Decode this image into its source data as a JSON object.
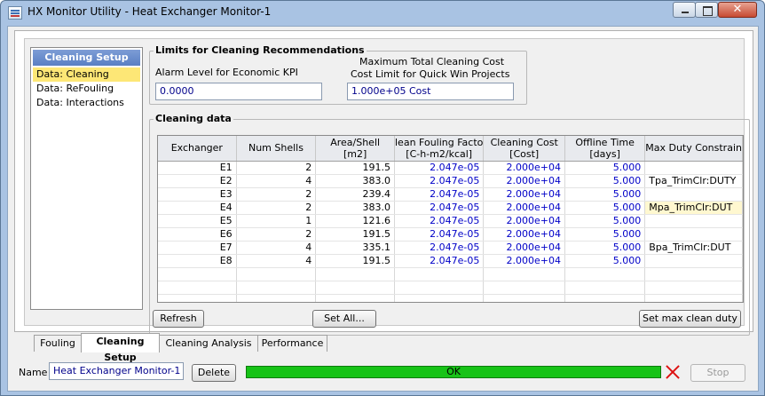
{
  "window": {
    "title": "HX Monitor Utility - Heat Exchanger Monitor-1"
  },
  "nav": {
    "header": "Cleaning Setup",
    "items": [
      {
        "label": "Data: Cleaning"
      },
      {
        "label": "Data: ReFouling"
      },
      {
        "label": "Data: Interactions"
      }
    ]
  },
  "limits": {
    "title": "Limits for Cleaning Recommendations",
    "alarm_label": "Alarm Level for Economic KPI",
    "alarm_value": "0.0000",
    "cost_label_1": "Maximum Total Cleaning Cost",
    "cost_label_2": "Cost Limit for Quick Win Projects",
    "cost_value": "1.000e+05 Cost"
  },
  "cleaning": {
    "title": "Cleaning data",
    "columns": [
      {
        "line1": "Exchanger",
        "line2": ""
      },
      {
        "line1": "Num Shells",
        "line2": ""
      },
      {
        "line1": "Area/Shell",
        "line2": "[m2]"
      },
      {
        "line1": "lean Fouling Facto",
        "line2": "[C-h-m2/kcal]"
      },
      {
        "line1": "Cleaning Cost",
        "line2": "[Cost]"
      },
      {
        "line1": "Offline Time",
        "line2": "[days]"
      },
      {
        "line1": "Max Duty Constrain",
        "line2": ""
      }
    ],
    "rows": [
      {
        "exchanger": "E1",
        "shells": "2",
        "area": "191.5",
        "fouling": "2.047e-05",
        "cost": "2.000e+04",
        "offline": "5.000",
        "constraint": ""
      },
      {
        "exchanger": "E2",
        "shells": "4",
        "area": "383.0",
        "fouling": "2.047e-05",
        "cost": "2.000e+04",
        "offline": "5.000",
        "constraint": "Tpa_TrimClr:DUTY"
      },
      {
        "exchanger": "E3",
        "shells": "2",
        "area": "239.4",
        "fouling": "2.047e-05",
        "cost": "2.000e+04",
        "offline": "5.000",
        "constraint": ""
      },
      {
        "exchanger": "E4",
        "shells": "2",
        "area": "383.0",
        "fouling": "2.047e-05",
        "cost": "2.000e+04",
        "offline": "5.000",
        "constraint": "Mpa_TrimClr:DUT"
      },
      {
        "exchanger": "E5",
        "shells": "1",
        "area": "121.6",
        "fouling": "2.047e-05",
        "cost": "2.000e+04",
        "offline": "5.000",
        "constraint": ""
      },
      {
        "exchanger": "E6",
        "shells": "2",
        "area": "191.5",
        "fouling": "2.047e-05",
        "cost": "2.000e+04",
        "offline": "5.000",
        "constraint": ""
      },
      {
        "exchanger": "E7",
        "shells": "4",
        "area": "335.1",
        "fouling": "2.047e-05",
        "cost": "2.000e+04",
        "offline": "5.000",
        "constraint": "Bpa_TrimClr:DUT"
      },
      {
        "exchanger": "E8",
        "shells": "4",
        "area": "191.5",
        "fouling": "2.047e-05",
        "cost": "2.000e+04",
        "offline": "5.000",
        "constraint": ""
      }
    ],
    "buttons": {
      "refresh": "Refresh",
      "set_all": "Set All...",
      "set_max": "Set max clean duty"
    }
  },
  "tabs": [
    {
      "label": "Fouling"
    },
    {
      "label": "Cleaning Setup"
    },
    {
      "label": "Cleaning Analysis"
    },
    {
      "label": "Performance"
    }
  ],
  "footer": {
    "name_label": "Name",
    "name_value": "Heat Exchanger Monitor-1",
    "delete": "Delete",
    "status": "OK",
    "stop": "Stop"
  },
  "icons": {
    "app": "app-icon",
    "minimize": "minimize-icon",
    "restore": "restore-icon",
    "close": "close-icon",
    "stop": "stop-x-icon"
  },
  "colors": {
    "status_ok": "#17c317",
    "value_blue": "#0000c8",
    "selected_nav": "#fde776",
    "highlight_cell": "#fff8d0"
  }
}
